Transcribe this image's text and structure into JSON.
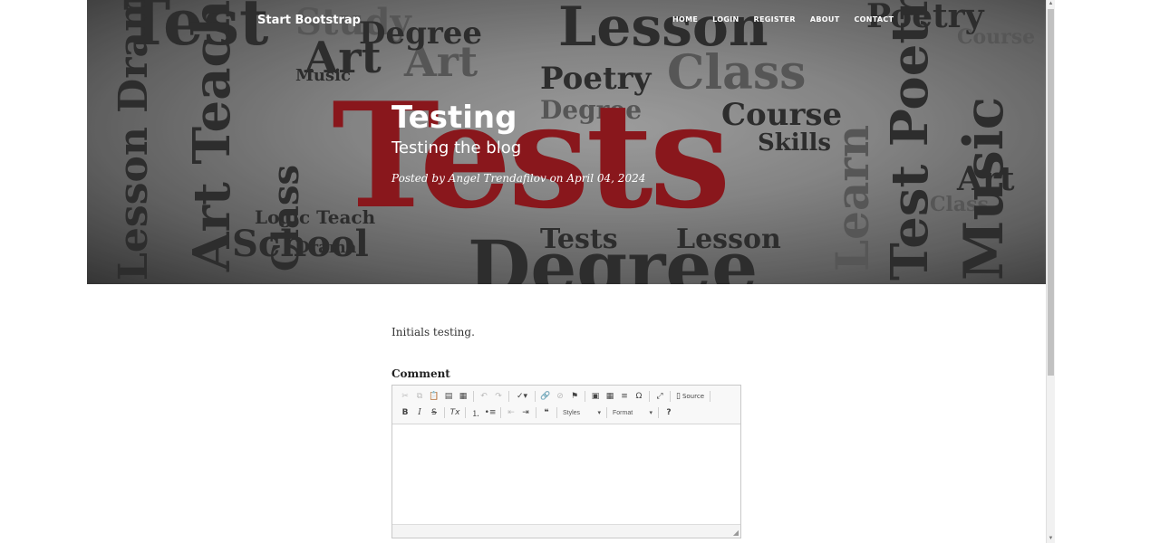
{
  "nav": {
    "brand": "Start Bootstrap",
    "links": [
      "HOME",
      "LOGIN",
      "REGISTER",
      "ABOUT",
      "CONTACT"
    ]
  },
  "post": {
    "title": "Testing",
    "subtitle": "Testing the blog",
    "meta": "Posted by Angel Trendafilov on April 04, 2024",
    "body": "Initials testing."
  },
  "comment": {
    "label": "Comment",
    "toolbar": {
      "source_label": "Source",
      "styles_label": "Styles",
      "format_label": "Format"
    }
  },
  "colors": {
    "accent_red": "#b01e24"
  }
}
